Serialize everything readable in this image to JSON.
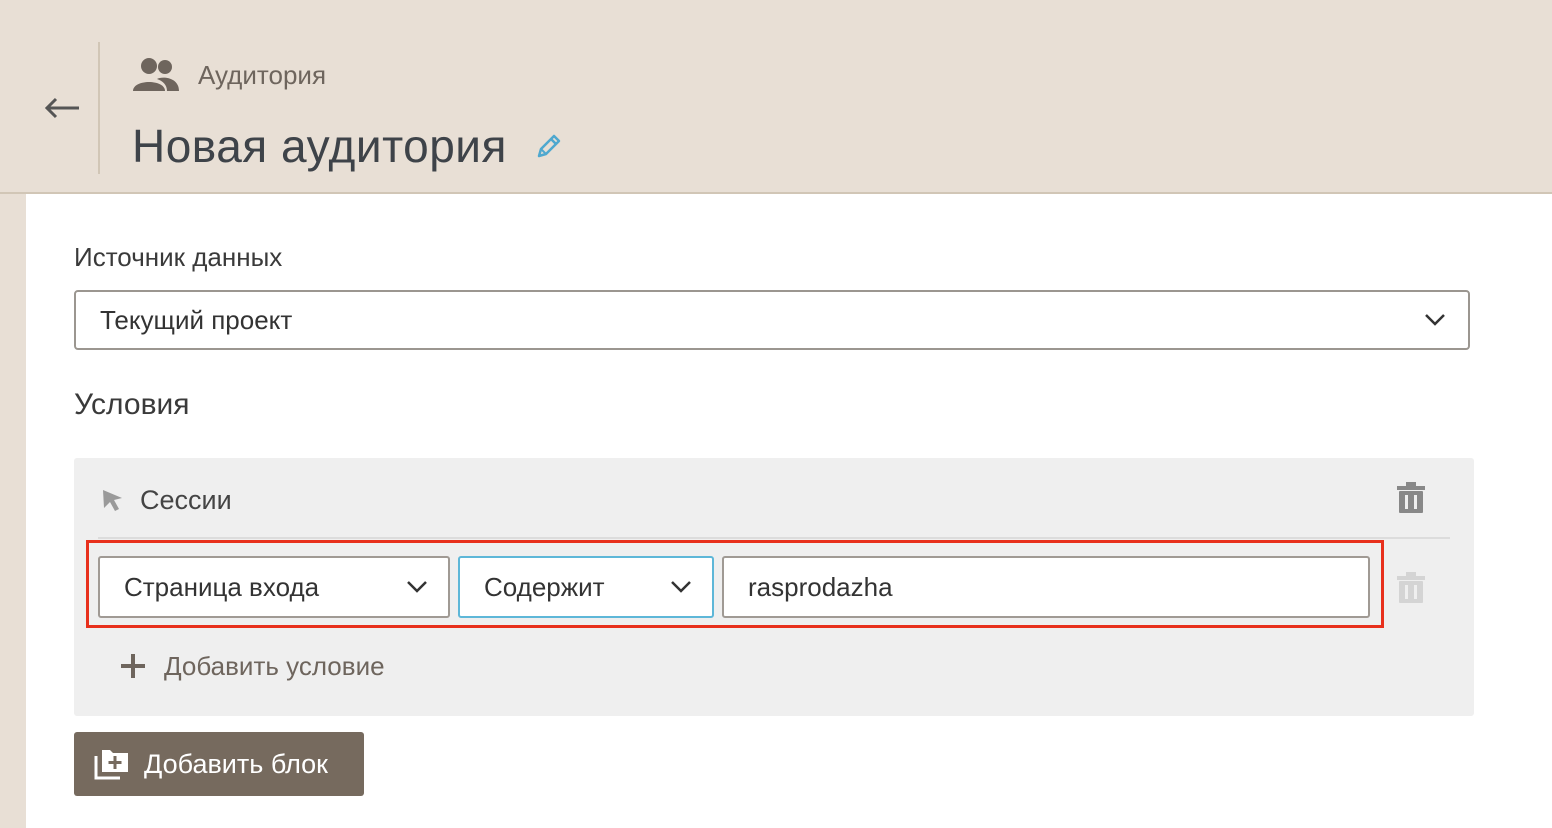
{
  "header": {
    "breadcrumb_label": "Аудитория",
    "page_title": "Новая аудитория"
  },
  "form": {
    "source_label": "Источник данных",
    "source_value": "Текущий проект",
    "conditions_title": "Условия"
  },
  "block": {
    "title": "Сессии",
    "condition": {
      "field_value": "Страница входа",
      "operator_value": "Содержит",
      "text_value": "rasprodazha"
    },
    "add_condition_label": "Добавить условие"
  },
  "actions": {
    "add_block_label": "Добавить блок"
  },
  "colors": {
    "header_bg": "#e8dfd5",
    "accent_blue": "#5eb7d8",
    "highlight_red": "#e8301c",
    "button_brown": "#766a5e"
  },
  "icons": {
    "back": "arrow-left-icon",
    "breadcrumb": "users-icon",
    "edit": "pencil-icon",
    "block": "cursor-icon",
    "delete": "trash-icon",
    "add": "plus-icon",
    "add_block": "add-folder-icon",
    "dropdown": "chevron-down-icon"
  }
}
